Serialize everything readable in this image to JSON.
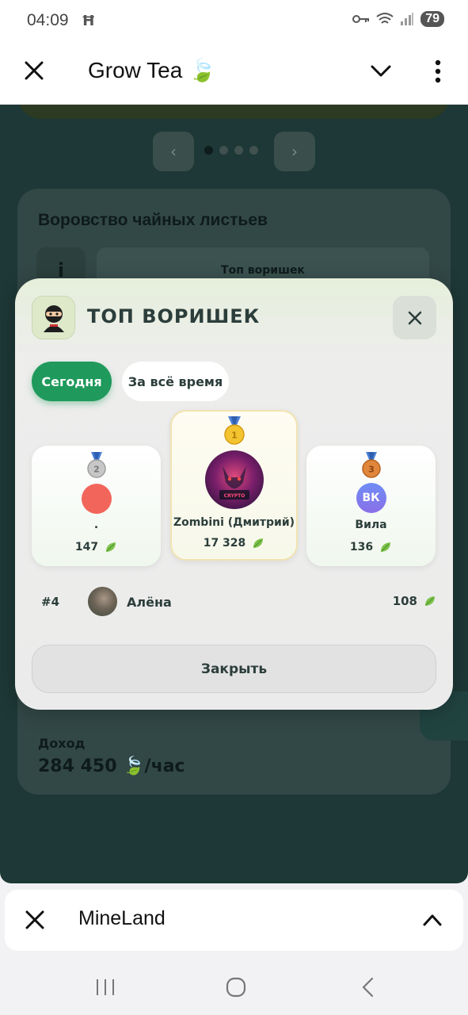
{
  "status_bar": {
    "time": "04:09",
    "battery": "79"
  },
  "app_header": {
    "title": "Grow Tea 🍃"
  },
  "background": {
    "prev": "‹",
    "next": "›",
    "card_title": "Воровство чайных листьев",
    "info_icon": "i",
    "top_button": "Топ воришек",
    "income_label": "Доход",
    "income_value": "284 450 🍃/час"
  },
  "modal": {
    "title": "ТОП ВОРИШЕК",
    "tabs": [
      "Сегодня",
      "За всё время"
    ],
    "active_tab": "Сегодня",
    "podium": [
      {
        "place": 2,
        "name": ".",
        "score": "147",
        "avatar_color": "#f2655a"
      },
      {
        "place": 1,
        "name": "Zombini (Дмитрий)",
        "score": "17 328"
      },
      {
        "place": 3,
        "name": "Вила",
        "score": "136",
        "avatar_initials": "ВК"
      }
    ],
    "rows": [
      {
        "rank": "#4",
        "name": "Алёна",
        "score": "108"
      }
    ],
    "close_label": "Закрыть"
  },
  "bottom_bar": {
    "title": "MineLand"
  },
  "colors": {
    "accent_green": "#1f9a5c",
    "text_dark": "#2c3e3b"
  }
}
